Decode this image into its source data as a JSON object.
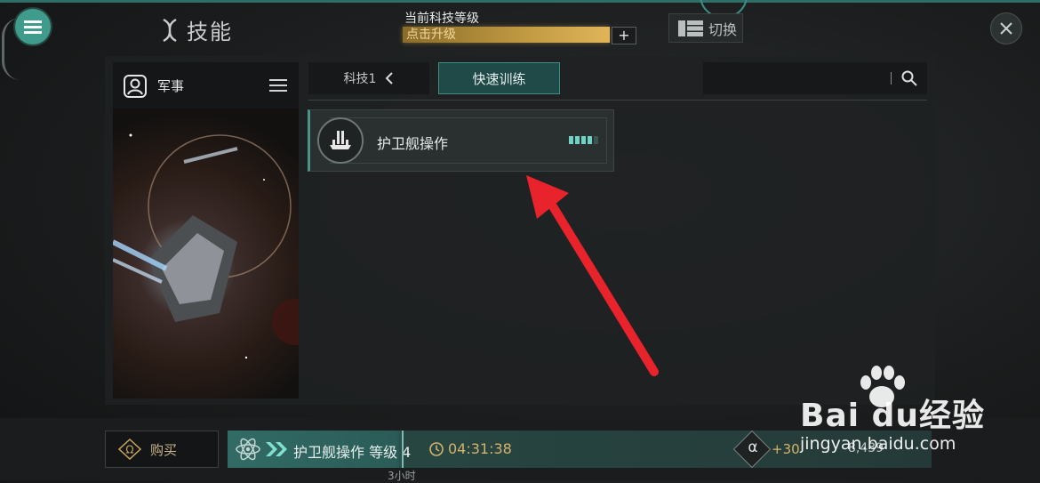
{
  "header": {
    "title": "技能",
    "level_label": "当前科技等级",
    "level_bar_text": "点击升级",
    "plus": "+",
    "switch_label": "切换"
  },
  "sidebar": {
    "title": "军事"
  },
  "tabs": {
    "keji": "科技1",
    "quick_train": "快速训练"
  },
  "search": {
    "placeholder": ""
  },
  "skills": [
    {
      "name": "护卫舰操作",
      "level_filled": 4,
      "level_total": 5
    }
  ],
  "queue": {
    "buy": "购买",
    "skill_text": "护卫舰操作 等级 4",
    "timer": "04:31:38",
    "alpha_symbol": "α",
    "plus_value": "+30",
    "count": "8,439",
    "under_label": "3小时"
  },
  "watermark": {
    "main": "Bai du经验",
    "sub": "jingyan.baidu.com"
  },
  "colors": {
    "accent": "#3f9c8c",
    "level_bar": "#c19a42",
    "arrow": "#e8232b"
  }
}
